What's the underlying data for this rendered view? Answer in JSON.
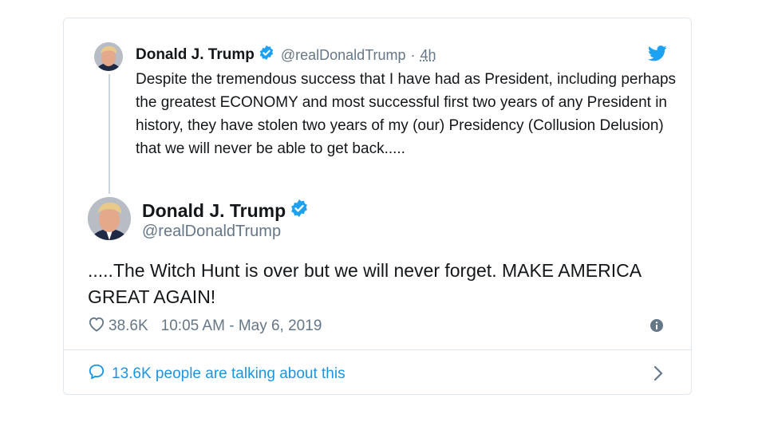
{
  "quoted_tweet": {
    "display_name": "Donald J. Trump",
    "handle": "@realDonaldTrump",
    "separator": "·",
    "time": "4h",
    "text": "Despite the tremendous success that I have had as President, including perhaps the greatest ECONOMY and most successful first two years of any President in history, they have stolen two years of my (our) Presidency (Collusion Delusion) that we will never be able to get back....."
  },
  "main_tweet": {
    "display_name": "Donald J. Trump",
    "handle": "@realDonaldTrump",
    "text": ".....The Witch Hunt is over but we will never forget. MAKE AMERICA GREAT AGAIN!",
    "likes": "38.6K",
    "timestamp": "10:05 AM - May 6, 2019"
  },
  "footer": {
    "talking_label": "13.6K people are talking about this"
  },
  "icons": {
    "verified": "verified-badge-icon",
    "bird": "twitter-bird-icon",
    "heart": "heart-icon",
    "info": "info-icon",
    "speech": "speech-bubble-icon",
    "chevron": "chevron-right-icon"
  },
  "colors": {
    "accent": "#1da1f2",
    "link": "#1b95e0",
    "muted": "#657786",
    "border": "#e1e8ed"
  }
}
